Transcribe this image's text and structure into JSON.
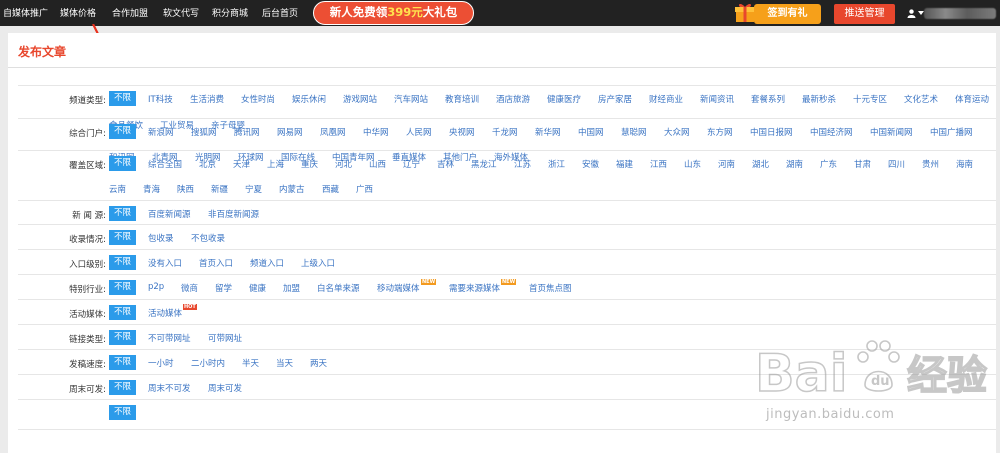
{
  "nav": {
    "items": [
      "自媒体推广",
      "媒体价格",
      "合作加盟",
      "软文代写",
      "积分商城",
      "后台首页"
    ],
    "promo": {
      "before": "新人免费领",
      "amount": "399元",
      "after": "大礼包"
    },
    "checkin_label": "签到有礼",
    "push_label": "推送管理"
  },
  "page": {
    "title": "发布文章"
  },
  "filters": [
    {
      "label": "频道类型:",
      "active": "不限",
      "options": [
        "IT科技",
        "生活消费",
        "女性时尚",
        "娱乐休闲",
        "游戏网站",
        "汽车网站",
        "教育培训",
        "酒店旅游",
        "健康医疗",
        "房产家居",
        "财经商业",
        "新闻资讯",
        "套餐系列",
        "最新秒杀",
        "十元专区",
        "文化艺术",
        "体育运动",
        "食品餐饮",
        "工业贸易",
        "亲子母婴"
      ]
    },
    {
      "label": "综合门户:",
      "active": "不限",
      "options": [
        "新浪网",
        "搜狐网",
        "腾讯网",
        "网易网",
        "凤凰网",
        "中华网",
        "人民网",
        "央视网",
        "千龙网",
        "新华网",
        "中国网",
        "慧聪网",
        "大众网",
        "东方网",
        "中国日报网",
        "中国经济网",
        "中国新闻网",
        "中国广播网",
        "和讯网",
        "北青网",
        "光明网",
        "环球网",
        "国际在线",
        "中国青年网",
        "垂直媒体",
        "其他门户",
        "海外媒体"
      ]
    },
    {
      "label": "覆盖区域:",
      "active": "不限",
      "options": [
        "综合全国",
        "北京",
        "天津",
        "上海",
        "重庆",
        "河北",
        "山西",
        "辽宁",
        "吉林",
        "黑龙江",
        "江苏",
        "浙江",
        "安徽",
        "福建",
        "江西",
        "山东",
        "河南",
        "湖北",
        "湖南",
        "广东",
        "甘肃",
        "四川",
        "贵州",
        "海南",
        "云南",
        "青海",
        "陕西",
        "新疆",
        "宁夏",
        "内蒙古",
        "西藏",
        "广西"
      ]
    },
    {
      "label": "新 闻 源:",
      "active": "不限",
      "options": [
        "百度新闻源",
        "非百度新闻源"
      ]
    },
    {
      "label": "收录情况:",
      "active": "不限",
      "options": [
        "包收录",
        "不包收录"
      ]
    },
    {
      "label": "入口级别:",
      "active": "不限",
      "options": [
        "没有入口",
        "首页入口",
        "频道入口",
        "上级入口"
      ]
    },
    {
      "label": "特别行业:",
      "active": "不限",
      "options": [
        "p2p",
        "微商",
        "留学",
        "健康",
        "加盟",
        "白名单来源",
        "移动端媒体",
        "需要来源媒体",
        "首页焦点图"
      ],
      "badges": {
        "6": "NEW",
        "7": "NEW"
      }
    },
    {
      "label": "活动媒体:",
      "active": "不限",
      "options": [
        "活动媒体"
      ],
      "badges": {
        "0": "HOT"
      }
    },
    {
      "label": "链接类型:",
      "active": "不限",
      "options": [
        "不可带网址",
        "可带网址"
      ]
    },
    {
      "label": "发稿速度:",
      "active": "不限",
      "options": [
        "一小时",
        "二小时内",
        "半天",
        "当天",
        "两天"
      ]
    },
    {
      "label": "周末可发:",
      "active": "不限",
      "options": [
        "周末不可发",
        "周末可发"
      ]
    },
    {
      "label": "",
      "active": "不限",
      "options": []
    }
  ],
  "watermark": {
    "logo": "Bai",
    "brand": "经验",
    "url": "jingyan.baidu.com"
  },
  "icons": [
    "gift-icon",
    "user-icon",
    "chevron-down-icon",
    "red-arrow-icon",
    "paw-icon"
  ],
  "colors": {
    "topbar": "#222222",
    "accent_red": "#e8472d",
    "active_blue": "#2b9bea",
    "link_blue": "#3b74c3",
    "checkin_orange": "#f6a01a"
  }
}
